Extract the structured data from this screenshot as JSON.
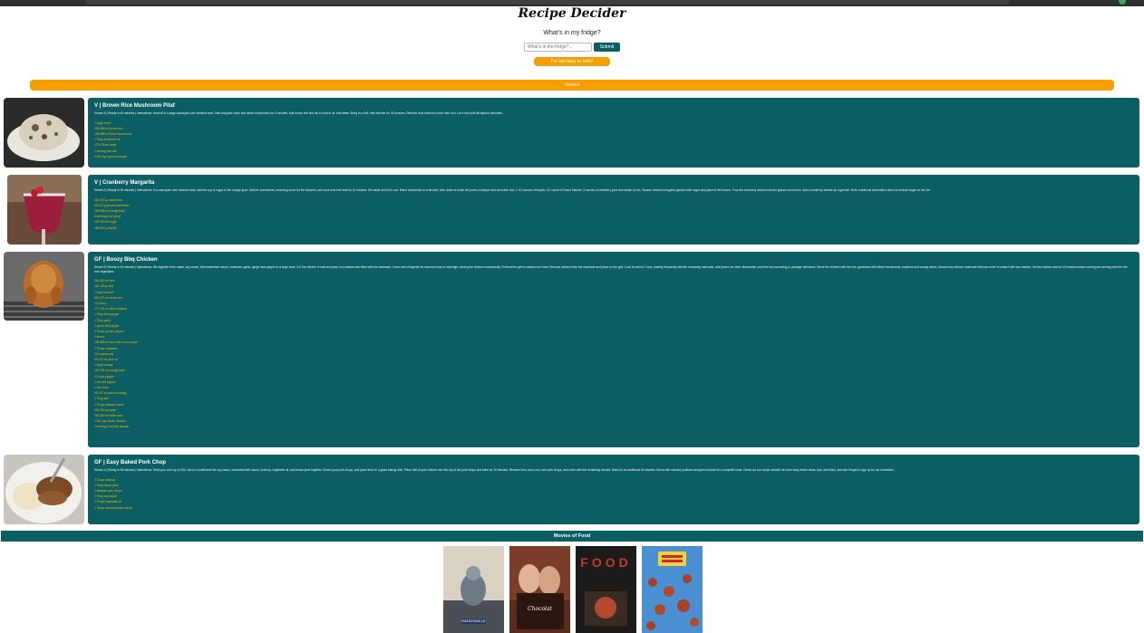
{
  "header": {
    "title": "Recipe Decider",
    "question": "What's in my fridge?",
    "search_placeholder": "What's in the fridge?...",
    "submit_label": "Submit",
    "lazy_label": "I'm too lazy to look!",
    "current_query": "chicken"
  },
  "recipes": [
    {
      "title": "V | Brown Rice Mushroom Pilaf",
      "description": "Serves 6 | Ready in 40 minutes | Instructions: Heat oil in a large saucepan over medium heat. Saut chopped onion and sliced mushrooms for 5 minutes. Add brown rice and stir to coat in oil. Add water. Bring to a boil, then simmer for 30 minutes. Remove from heat and cover with a lid. Let it rest until all liquid is absorbed.",
      "ingredients": [
        "1 large onion",
        "236.588 ml brown rice",
        "236.588 ml fresh mushrooms",
        "1 Tbsp sunflower oil",
        "473.176 ml water",
        "1 serving sea salt",
        "0.333 tsps ground pepper"
      ]
    },
    {
      "title": "V | Cranberry Margarita",
      "description": "Serves 6 | Ready in 45 minutes | Instructions: In a saucepan over medium heat, add the cup of sugar to the orange juice. Add the cranberries, reserving some for the skewers, and cook over low heat for 10 minutes. Set aside and let it cool. Blend cranberries in a blender, then strain to make the purée a sharper and smoother mix, 1 1/4 ounces of tequila, 1/2 ounce of Grand Marnier, 3 ounces of cranberry juice and shake to mix. Season rimmed margarita glasses with sugar and place in the freezer. Pour the cranberry mixture into the glasses and serve. Add a cranberry skewer as a garnish. Note: nutritional information does not include sugar on the rim.",
      "ingredients": [
        "453.592 g cranberries",
        "58.233 g ground sweetener",
        "236.588 ml orange juice",
        "6 servings rice syrup",
        "100.000 ml sugar",
        "283.000 g tequila"
      ]
    },
    {
      "title": "GF | Boozy Bbq Chicken",
      "description": "Serves 6 | Ready in 45 minutes | Instructions: Mix together beer, water, soy sauce, Worcestershire sauce, molasses, garlic, ginger and pepper in a large bowl. Cut the chicken in half and place in a shallow dish filled with the marinade. Cover and refrigerate for several hours or overnight, turning the chicken occasionally. Preheat the grill to medium-low heat. Remove chicken from the marinade and place on the grill. Cook for about 1 hour, basting frequently with the remaining marinade, until juices run clear. Meanwhile, cook the rice according to package directions. Serve the chicken with the rice, garnished with sliced mushrooms, scallions and orange slices. Discard any leftover marinade that has come in contact with raw chicken. Let the chicken rest for 10 minutes before carving and serving with the rice and vegetables.",
      "ingredients": [
        "354.882 ml beer",
        "340.194 g beef",
        "1 head broccoli",
        "591.471 ml brown rice",
        "12 cherry",
        "177.441 ml dijon mustard",
        "1 Tbsp fresh ginger",
        "1 Tbsp garlic",
        "1 green bell pepper",
        "2 Tbsps ground pepper",
        "1 lemon",
        "236.588 ml low sodium soy sauce",
        "2 Tbsps molasses",
        "10 mushrooms",
        "59.147 ml olive oil",
        "1 large orange",
        "118.294 ml orange juice",
        "0.5 tsps pepper",
        "1 red bell pepper",
        "1 red onion",
        "59.147 ml salad dressing",
        "1 Tbsp salt",
        "2 Tbsps tabasco sauce",
        "946.353 ml water",
        "354.882 ml white wine",
        "1.361 kgs whole chicken",
        "2 servings zucchini squash"
      ]
    },
    {
      "title": "GF | Easy Baked Pork Chop",
      "description": "Serves 4 | Ready in 45 minutes | Instructions: Heat your oven up to 350. Mix in a small bowl the soy sauce, worcestershire sauce, ketchup, vegetable oil, and lemon juice together. Brown your pork chops, and place them in a glass baking dish. Place half of your mixture over the top of the pork chops and bake for 30 minutes. Remove from oven, turn over pork chops, and cover with the remaining mixture. Bake for an additional 20 minutes. Serve with mashed potatoes and green beans for a complete meal. Check out our recipe website for more easy dinner ideas, tips, and tricks, and don't forget to sign up for our newsletter.",
      "ingredients": [
        "3 Tbsps ketchup",
        "1 Tbsp lemon juice",
        "4 medium pork chops",
        "1 Tbsp soy sauce",
        "2 Tbsps vegetable oil",
        "2 Tbsps worcestershire sauce"
      ]
    }
  ],
  "movies": {
    "heading": "Movies of Food",
    "posters": [
      {
        "name": "Ratatouille",
        "caption": "RATATOUILLE",
        "color": "#d9d2c4"
      },
      {
        "name": "Chocolat",
        "caption": "Chocolat",
        "color": "#5a2a1c"
      },
      {
        "name": "Food",
        "caption": "FOOD",
        "color": "#1b1b1b"
      },
      {
        "name": "Cloudy with a Chance of Meatballs",
        "caption": "",
        "color": "#4a8fd1"
      }
    ]
  },
  "colors": {
    "teal": "#0b5e63",
    "orange": "#f5a000",
    "ingredient": "#f5b400"
  }
}
